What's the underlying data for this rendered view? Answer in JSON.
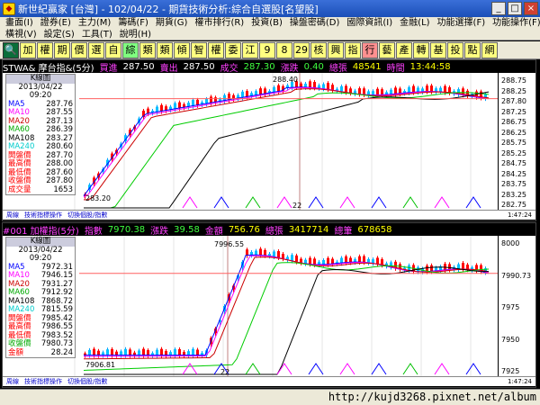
{
  "window": {
    "title": "新世紀贏家 [台灣] - 102/04/22 - 期貨技術分析:綜合自選股[名望股]"
  },
  "menu": {
    "row1": [
      "畫面(I)",
      "證券(E)",
      "主力(M)",
      "籌碼(F)",
      "期貨(G)",
      "權市排行(R)",
      "投資(B)",
      "操盤密碼(D)",
      "國際資訊(I)",
      "金融(L)",
      "功能選擇(F)",
      "功能操作(F)"
    ],
    "row2": [
      "橫視(V)",
      "設定(S)",
      "工具(T)",
      "說明(H)"
    ]
  },
  "toolbar": [
    {
      "label": "加",
      "color": "#ffff80"
    },
    {
      "label": "權",
      "color": "#ffff80"
    },
    {
      "label": "期",
      "color": "#ffff80"
    },
    {
      "label": "價",
      "color": "#ffff80"
    },
    {
      "label": "選",
      "color": "#ffff80"
    },
    {
      "label": "自",
      "color": "#ffff80"
    },
    {
      "label": "綜",
      "color": "#80ff80"
    },
    {
      "label": "類",
      "color": "#ffff80"
    },
    {
      "label": "類",
      "color": "#ffff80"
    },
    {
      "label": "傾",
      "color": "#ffff80"
    },
    {
      "label": "智",
      "color": "#ffff80"
    },
    {
      "label": "權",
      "color": "#ffff80"
    },
    {
      "label": "委",
      "color": "#ffff80"
    },
    {
      "label": "江",
      "color": "#ffff80"
    },
    {
      "label": "9",
      "color": "#ffff80"
    },
    {
      "label": "8",
      "color": "#ffff80"
    },
    {
      "label": "29",
      "color": "#ffff80"
    },
    {
      "label": "核",
      "color": "#ffff80"
    },
    {
      "label": "興",
      "color": "#ffff80"
    },
    {
      "label": "指",
      "color": "#ffff80"
    },
    {
      "label": "行",
      "color": "#ff9090"
    },
    {
      "label": "藝",
      "color": "#ffff80"
    },
    {
      "label": "產",
      "color": "#ffff80"
    },
    {
      "label": "轉",
      "color": "#ffff80"
    },
    {
      "label": "基",
      "color": "#ffff80"
    },
    {
      "label": "投",
      "color": "#ffff80"
    },
    {
      "label": "點",
      "color": "#ffff80"
    },
    {
      "label": "網",
      "color": "#ffff80"
    }
  ],
  "pane1": {
    "header": [
      {
        "text": "STWA& 摩台指&(5分)",
        "color": "#ffffff"
      },
      {
        "text": "買進",
        "color": "#ff40ff"
      },
      {
        "text": "287.50",
        "color": "#ffffff"
      },
      {
        "text": "賣出",
        "color": "#ff40ff"
      },
      {
        "text": "287.50",
        "color": "#ffffff"
      },
      {
        "text": "成交",
        "color": "#ff40ff"
      },
      {
        "text": "287.30",
        "color": "#40ff40"
      },
      {
        "text": "漲跌",
        "color": "#ff40ff"
      },
      {
        "text": "0.40",
        "color": "#40ff40"
      },
      {
        "text": "總張",
        "color": "#ff40ff"
      },
      {
        "text": "48541",
        "color": "#ffff00"
      },
      {
        "text": "時間",
        "color": "#ff40ff"
      },
      {
        "text": "13:44:58",
        "color": "#ffff00"
      }
    ],
    "info_title": "K線圖",
    "info_date": "2013/04/22 09:20",
    "info_rows": [
      {
        "k": "MA5",
        "v": "287.76",
        "c": "#0000ff"
      },
      {
        "k": "MA10",
        "v": "287.55",
        "c": "#ff00ff"
      },
      {
        "k": "MA20",
        "v": "287.13",
        "c": "#cc0000"
      },
      {
        "k": "MA60",
        "v": "286.39",
        "c": "#00aa00"
      },
      {
        "k": "MA108",
        "v": "283.27",
        "c": "#000000"
      },
      {
        "k": "MA240",
        "v": "280.60",
        "c": "#00cccc"
      },
      {
        "k": "開盤價",
        "v": "287.70",
        "c": "#ff0000"
      },
      {
        "k": "最高價",
        "v": "288.00",
        "c": "#ff0000"
      },
      {
        "k": "最低價",
        "v": "287.60",
        "c": "#ff0000"
      },
      {
        "k": "收盤價",
        "v": "287.80",
        "c": "#ff0000"
      },
      {
        "k": "成交量",
        "v": "1653",
        "c": "#ff0000"
      }
    ],
    "ticks": [
      "288.75",
      "288.25",
      "287.80",
      "287.25",
      "286.75",
      "286.25",
      "285.75",
      "285.25",
      "284.75",
      "284.25",
      "283.75",
      "283.25",
      "282.75"
    ],
    "label_high": "288.40",
    "label_low": "283.20",
    "label_day": "22",
    "mini_text": [
      "周線",
      "技術指標操作",
      "切換個股/指數"
    ],
    "mini_right": "1:47:24"
  },
  "pane2": {
    "header": [
      {
        "text": "#001 加權指(5分)",
        "color": "#ff40ff"
      },
      {
        "text": "指數",
        "color": "#ff40ff"
      },
      {
        "text": "7970.38",
        "color": "#40ff40"
      },
      {
        "text": "漲跌",
        "color": "#ff40ff"
      },
      {
        "text": "39.58",
        "color": "#40ff40"
      },
      {
        "text": "金額",
        "color": "#ff40ff"
      },
      {
        "text": "756.76",
        "color": "#ffff00"
      },
      {
        "text": "總張",
        "color": "#ff40ff"
      },
      {
        "text": "3417714",
        "color": "#ffff00"
      },
      {
        "text": "總筆",
        "color": "#ff40ff"
      },
      {
        "text": "678658",
        "color": "#ffff00"
      }
    ],
    "info_title": "K線圖",
    "info_date": "2013/04/22 09:20",
    "info_rows": [
      {
        "k": "MA5",
        "v": "7972.31",
        "c": "#0000ff"
      },
      {
        "k": "MA10",
        "v": "7946.15",
        "c": "#ff00ff"
      },
      {
        "k": "MA20",
        "v": "7931.27",
        "c": "#cc0000"
      },
      {
        "k": "MA60",
        "v": "7912.92",
        "c": "#00aa00"
      },
      {
        "k": "MA108",
        "v": "7868.72",
        "c": "#000000"
      },
      {
        "k": "MA240",
        "v": "7815.59",
        "c": "#00cccc"
      },
      {
        "k": "開盤價",
        "v": "7985.42",
        "c": "#ff0000"
      },
      {
        "k": "最高價",
        "v": "7986.55",
        "c": "#ff0000"
      },
      {
        "k": "最低價",
        "v": "7983.52",
        "c": "#ff0000"
      },
      {
        "k": "收盤價",
        "v": "7980.73",
        "c": "#00aa00"
      },
      {
        "k": "金額",
        "v": "28.24",
        "c": "#ff0000"
      }
    ],
    "ticks": [
      "8000",
      "7990.73",
      "7975",
      "7950",
      "7925"
    ],
    "label_high": "7996.55",
    "label_low": "7906.81",
    "label_day": "22",
    "mini_text": [
      "周線",
      "技術指標操作",
      "切換個股/指數"
    ],
    "mini_right": "1:47:24"
  },
  "status": {
    "url": "http://kujd3268.pixnet.net/album"
  }
}
